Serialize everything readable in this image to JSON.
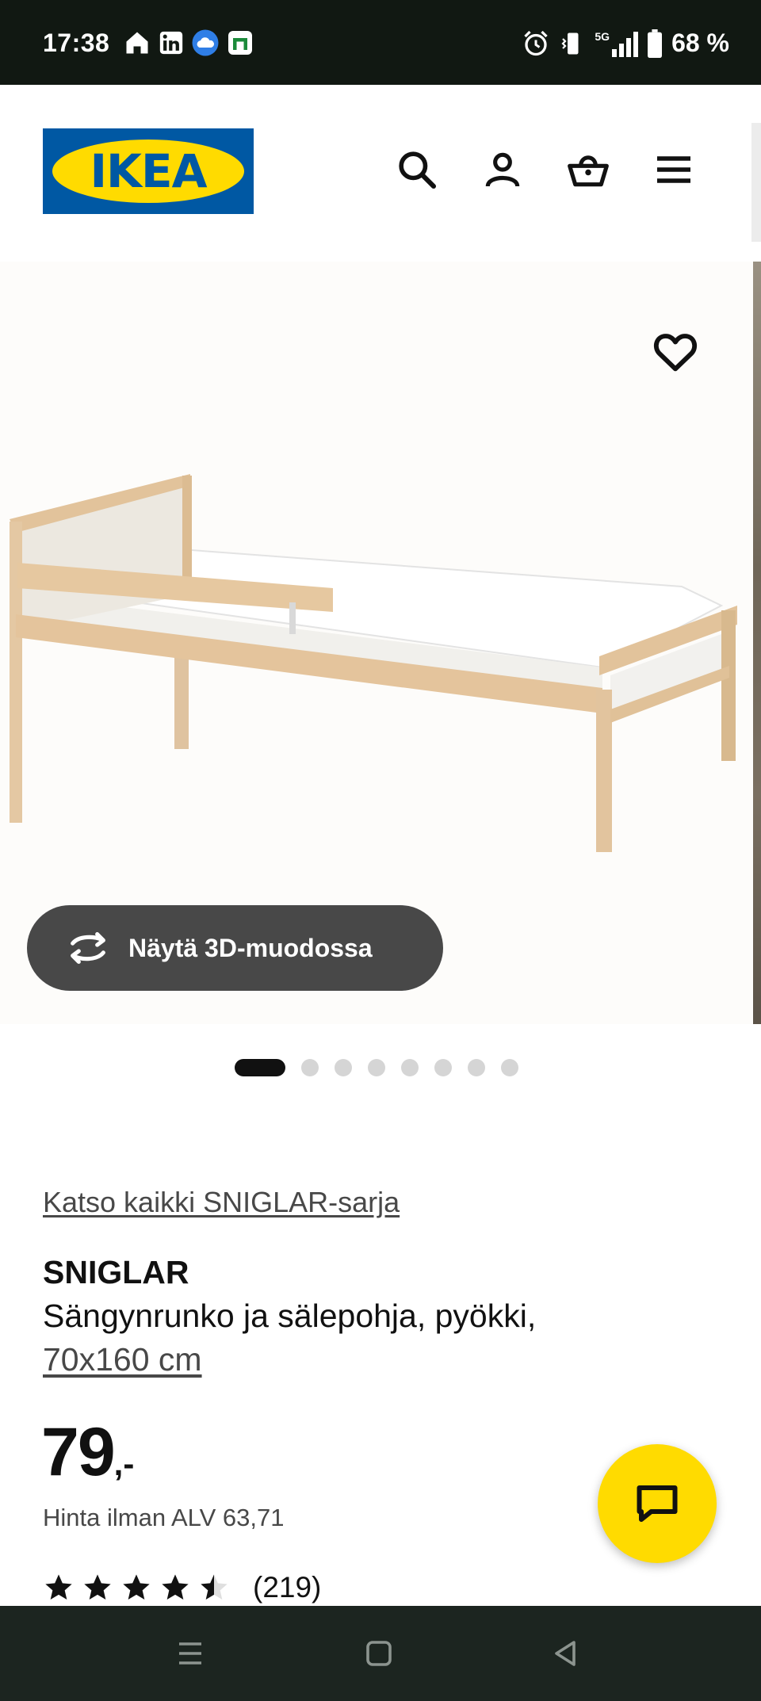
{
  "status_bar": {
    "time": "17:38",
    "battery": "68 %",
    "left_icons": [
      "home-icon",
      "linkedin-icon",
      "weather-icon",
      "calendar-app-icon"
    ],
    "right_icons": [
      "alarm-icon",
      "vibrate-icon",
      "signal-5g-icon",
      "battery-icon"
    ],
    "network_label": "5G"
  },
  "header": {
    "logo_text": "IKEA",
    "icons": [
      "search-icon",
      "account-icon",
      "cart-icon",
      "menu-icon"
    ],
    "brand_colors": {
      "blue": "#0058a3",
      "yellow": "#ffdb00"
    }
  },
  "gallery": {
    "button_3d_label": "Näytä 3D-muodossa",
    "slide_count": 8,
    "active_slide": 1,
    "favorite_icon": "heart-icon"
  },
  "product": {
    "series_link": "Katso kaikki SNIGLAR-sarja",
    "name": "SNIGLAR",
    "description": "Sängynrunko ja sälepohja, pyökki,",
    "size": "70x160 cm",
    "price_integer": "79",
    "price_decimal": ",-",
    "vat_text": "Hinta ilman ALV 63,71",
    "rating_value": 4.5,
    "rating_max": 5,
    "rating_count": "(219)"
  },
  "chat": {
    "icon": "chat-icon"
  },
  "nav_bar": {
    "icons": [
      "recent-apps-icon",
      "home-button-icon",
      "back-icon"
    ]
  }
}
